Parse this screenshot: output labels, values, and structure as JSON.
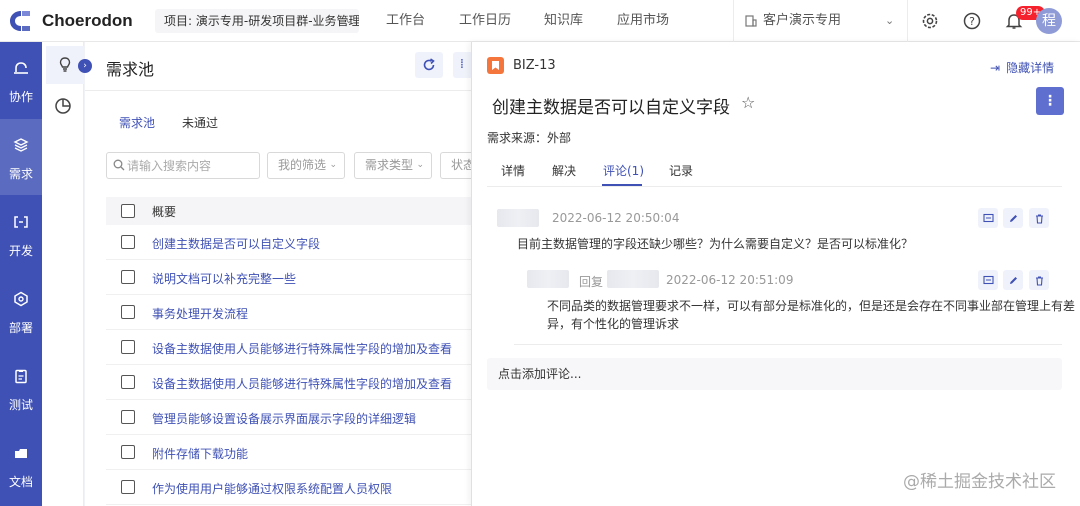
{
  "header": {
    "app_name": "Choerodon",
    "project": "项目: 演示专用-研发项目群-业务管理",
    "nav": [
      "工作台",
      "工作日历",
      "知识库",
      "应用市场"
    ],
    "org": "客户演示专用",
    "notification_badge": "99+",
    "avatar_text": "程"
  },
  "sidebar": {
    "items": [
      {
        "label": "协作",
        "icon": "collaborate-icon"
      },
      {
        "label": "需求",
        "icon": "layers-icon"
      },
      {
        "label": "开发",
        "icon": "code-icon"
      },
      {
        "label": "部署",
        "icon": "deploy-icon"
      },
      {
        "label": "测试",
        "icon": "clipboard-icon"
      },
      {
        "label": "文档",
        "icon": "document-icon"
      }
    ],
    "active": "需求"
  },
  "subnav": {
    "items": [
      "lightbulb-icon",
      "pie-chart-icon"
    ]
  },
  "main": {
    "title": "需求池",
    "tabs": [
      "需求池",
      "未通过"
    ],
    "search": {
      "placeholder": "请输入搜索内容",
      "value": ""
    },
    "filters": [
      "我的筛选",
      "需求类型",
      "状态"
    ],
    "column_header": "概要",
    "rows": [
      "创建主数据是否可以自定义字段",
      "说明文档可以补充完整一些",
      "事务处理开发流程",
      "设备主数据使用人员能够进行特殊属性字段的增加及查看",
      "设备主数据使用人员能够进行特殊属性字段的增加及查看",
      "管理员能够设置设备展示界面展示字段的详细逻辑",
      "附件存储下载功能",
      "作为使用用户能够通过权限系统配置人员权限"
    ]
  },
  "detail": {
    "issue_key": "BIZ-13",
    "hide_label": "隐藏详情",
    "title": "创建主数据是否可以自定义字段",
    "source": "需求来源：外部",
    "tabs": [
      "详情",
      "解决",
      "评论(1)",
      "记录"
    ],
    "active_tab": "评论(1)",
    "comment": {
      "time": "2022-06-12 20:50:04",
      "text": "目前主数据管理的字段还缺少哪些？为什么需要自定义？是否可以标准化？",
      "reply": {
        "reply_label": "回复",
        "time": "2022-06-12 20:51:09",
        "text_line1": "不同品类的数据管理要求不一样，可以有部分是标准化的，但是还是会存在不同事业部在管理上有差",
        "text_line2": "异，有个性化的管理诉求"
      }
    },
    "add_comment": "点击添加评论..."
  },
  "watermark": "@稀土掘金技术社区",
  "colors": {
    "primary": "#3f51b5",
    "issue_type": "#f5763d",
    "badge": "#f5222d"
  }
}
